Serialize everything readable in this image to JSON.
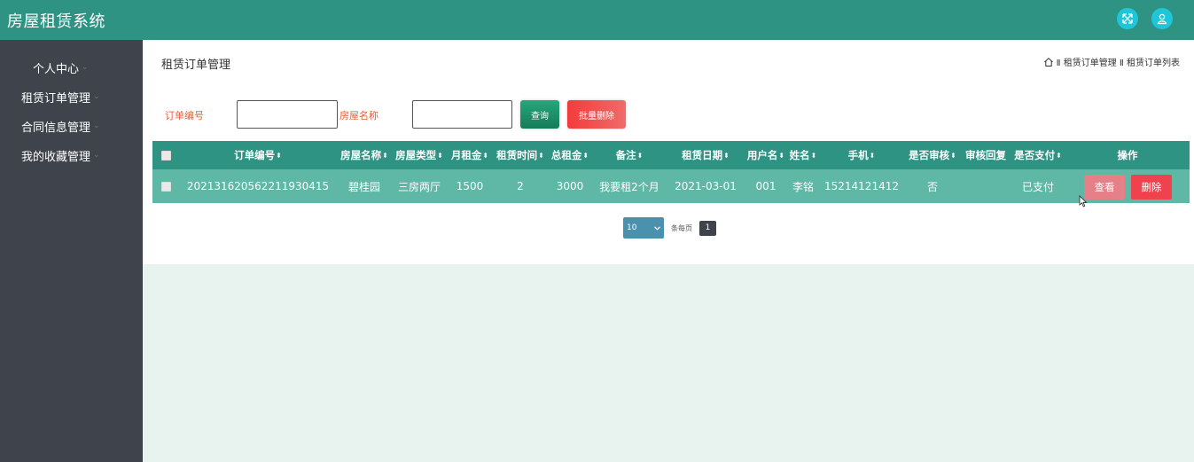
{
  "app": {
    "title": "房屋租赁系统"
  },
  "topbar": {
    "fullscreen_icon": "fullscreen-icon",
    "user_icon": "user-icon"
  },
  "sidebar": {
    "items": [
      {
        "label": "个人中心"
      },
      {
        "label": "租赁订单管理"
      },
      {
        "label": "合同信息管理"
      },
      {
        "label": "我的收藏管理"
      }
    ],
    "caret": "⌄"
  },
  "page": {
    "title": "租赁订单管理",
    "breadcrumb": "Ⅱ 租赁订单管理 Ⅱ 租赁订单列表"
  },
  "search": {
    "order_no_label": "订单编号",
    "order_no_value": "",
    "house_name_label": "房屋名称",
    "house_name_value": "",
    "query_label": "查询",
    "batch_delete_label": "批量删除"
  },
  "table": {
    "sort_glyph": "⬍",
    "headers": {
      "order_no": "订单编号",
      "house_name": "房屋名称",
      "house_type": "房屋类型",
      "monthly_rent": "月租金",
      "lease_term": "租赁时间",
      "total_rent": "总租金",
      "remark": "备注",
      "lease_date": "租赁日期",
      "username": "用户名",
      "name": "姓名",
      "phone": "手机",
      "is_reviewed": "是否审核",
      "review_reply": "审核回复",
      "is_paid": "是否支付",
      "actions": "操作"
    },
    "rows": [
      {
        "order_no": "20213162056221193041​5",
        "house_name": "碧桂园",
        "house_type": "三房两厅",
        "monthly_rent": "1500",
        "lease_term": "2",
        "total_rent": "3000",
        "remark": "我要租2个月",
        "lease_date": "2021-03-01",
        "username": "001",
        "name": "李铭",
        "phone": "15214121412",
        "is_reviewed": "否",
        "review_reply": "",
        "is_paid": "已支付",
        "view_label": "查看",
        "delete_label": "删除"
      }
    ]
  },
  "pagination": {
    "page_size": "10",
    "per_page_label": "条每页",
    "current_page": "1"
  }
}
